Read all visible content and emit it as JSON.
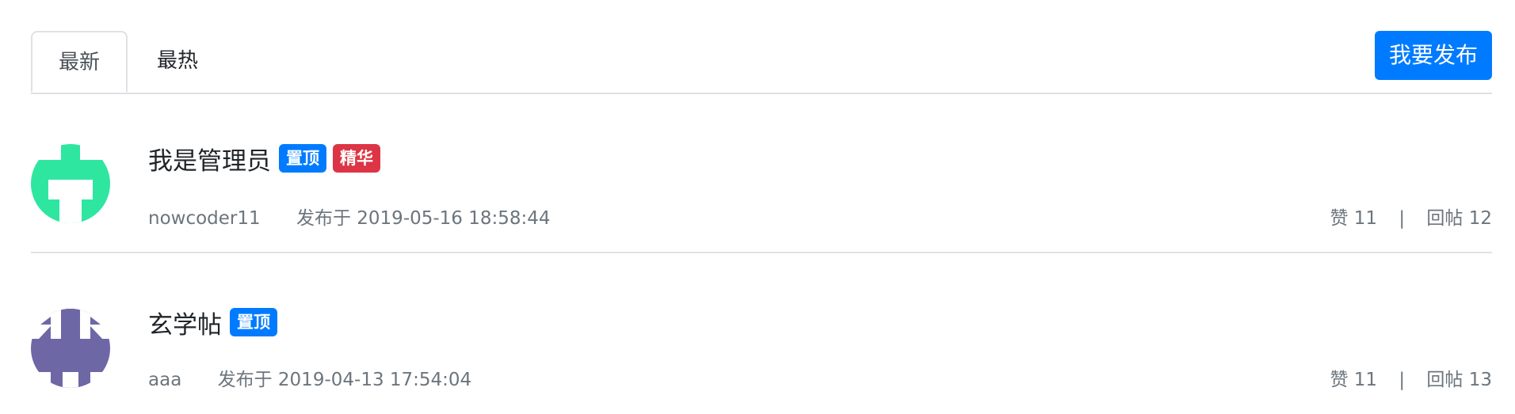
{
  "tabs": [
    {
      "label": "最新",
      "active": true
    },
    {
      "label": "最热",
      "active": false
    }
  ],
  "publish_button": "我要发布",
  "colors": {
    "primary": "#007bff",
    "danger": "#dc3545",
    "muted": "#6c757d",
    "border": "#dee2e6"
  },
  "posts": [
    {
      "title": "我是管理员",
      "badges": [
        "置顶",
        "精华"
      ],
      "author": "nowcoder11",
      "published": "发布于 2019-05-16 18:58:44",
      "likes": "赞 11",
      "separator": "|",
      "replies": "回帖 12",
      "avatar_color": "#2ee6a0",
      "avatar_icon": "identicon-avatar"
    },
    {
      "title": "玄学帖",
      "badges": [
        "置顶"
      ],
      "author": "aaa",
      "published": "发布于 2019-04-13 17:54:04",
      "likes": "赞 11",
      "separator": "|",
      "replies": "回帖 13",
      "avatar_color": "#6e67a6",
      "avatar_icon": "identicon-avatar"
    }
  ]
}
